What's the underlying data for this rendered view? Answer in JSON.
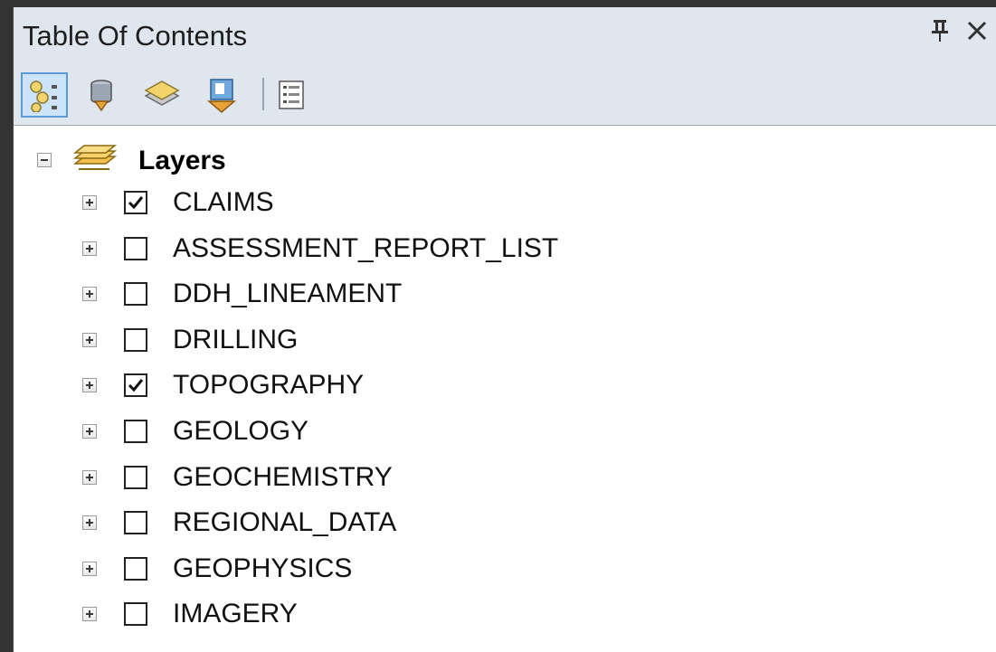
{
  "window": {
    "title": "Table Of Contents",
    "pin_glyph": "ѱ",
    "close_glyph": "✕"
  },
  "toolbar": {
    "tools": [
      {
        "name": "list-by-drawing-order-icon",
        "active": true
      },
      {
        "name": "list-by-source-icon",
        "active": false
      },
      {
        "name": "list-by-visibility-icon",
        "active": false
      },
      {
        "name": "list-by-selection-icon",
        "active": false
      },
      {
        "name": "options-icon",
        "active": false
      }
    ]
  },
  "tree": {
    "root": {
      "label": "Layers",
      "expanded": true,
      "icon": "layers-icon"
    },
    "layers": [
      {
        "label": "CLAIMS",
        "checked": true
      },
      {
        "label": "ASSESSMENT_REPORT_LIST",
        "checked": false
      },
      {
        "label": "DDH_LINEAMENT",
        "checked": false
      },
      {
        "label": "DRILLING",
        "checked": false
      },
      {
        "label": "TOPOGRAPHY",
        "checked": true
      },
      {
        "label": "GEOLOGY",
        "checked": false
      },
      {
        "label": "GEOCHEMISTRY",
        "checked": false
      },
      {
        "label": "REGIONAL_DATA",
        "checked": false
      },
      {
        "label": "GEOPHYSICS",
        "checked": false
      },
      {
        "label": "IMAGERY",
        "checked": false
      }
    ]
  },
  "colors": {
    "header_bg": "#dfe6ee",
    "active_tool_border": "#5a9bd8",
    "active_tool_bg": "#cde3f7"
  }
}
